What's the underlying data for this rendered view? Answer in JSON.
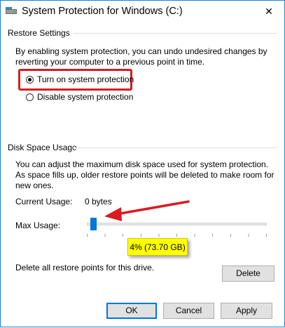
{
  "window": {
    "title": "System Protection for Windows (C:)",
    "close_glyph": "✕"
  },
  "restore_settings": {
    "group_title": "Restore Settings",
    "description": "By enabling system protection, you can undo undesired changes by reverting your computer to a previous point in time.",
    "options": [
      {
        "label": "Turn on system protection",
        "selected": true
      },
      {
        "label": "Disable system protection",
        "selected": false
      }
    ]
  },
  "disk_space": {
    "group_title": "Disk Space Usage",
    "description": "You can adjust the maximum disk space used for system protection. As space fills up, older restore points will be deleted to make room for new ones.",
    "current_usage_label": "Current Usage:",
    "current_usage_value": "0 bytes",
    "max_usage_label": "Max Usage:",
    "max_usage_fraction": 0.04,
    "max_usage_tooltip": "4% (73.70 GB)",
    "delete_text": "Delete all restore points for this drive.",
    "delete_button": "Delete"
  },
  "footer": {
    "ok": "OK",
    "cancel": "Cancel",
    "apply": "Apply"
  },
  "colors": {
    "accent": "#0078d7",
    "highlight_box": "#d81c22",
    "tooltip_bg": "#ffff00"
  },
  "icons": {
    "app": "system-protection-icon",
    "close": "close-icon"
  }
}
